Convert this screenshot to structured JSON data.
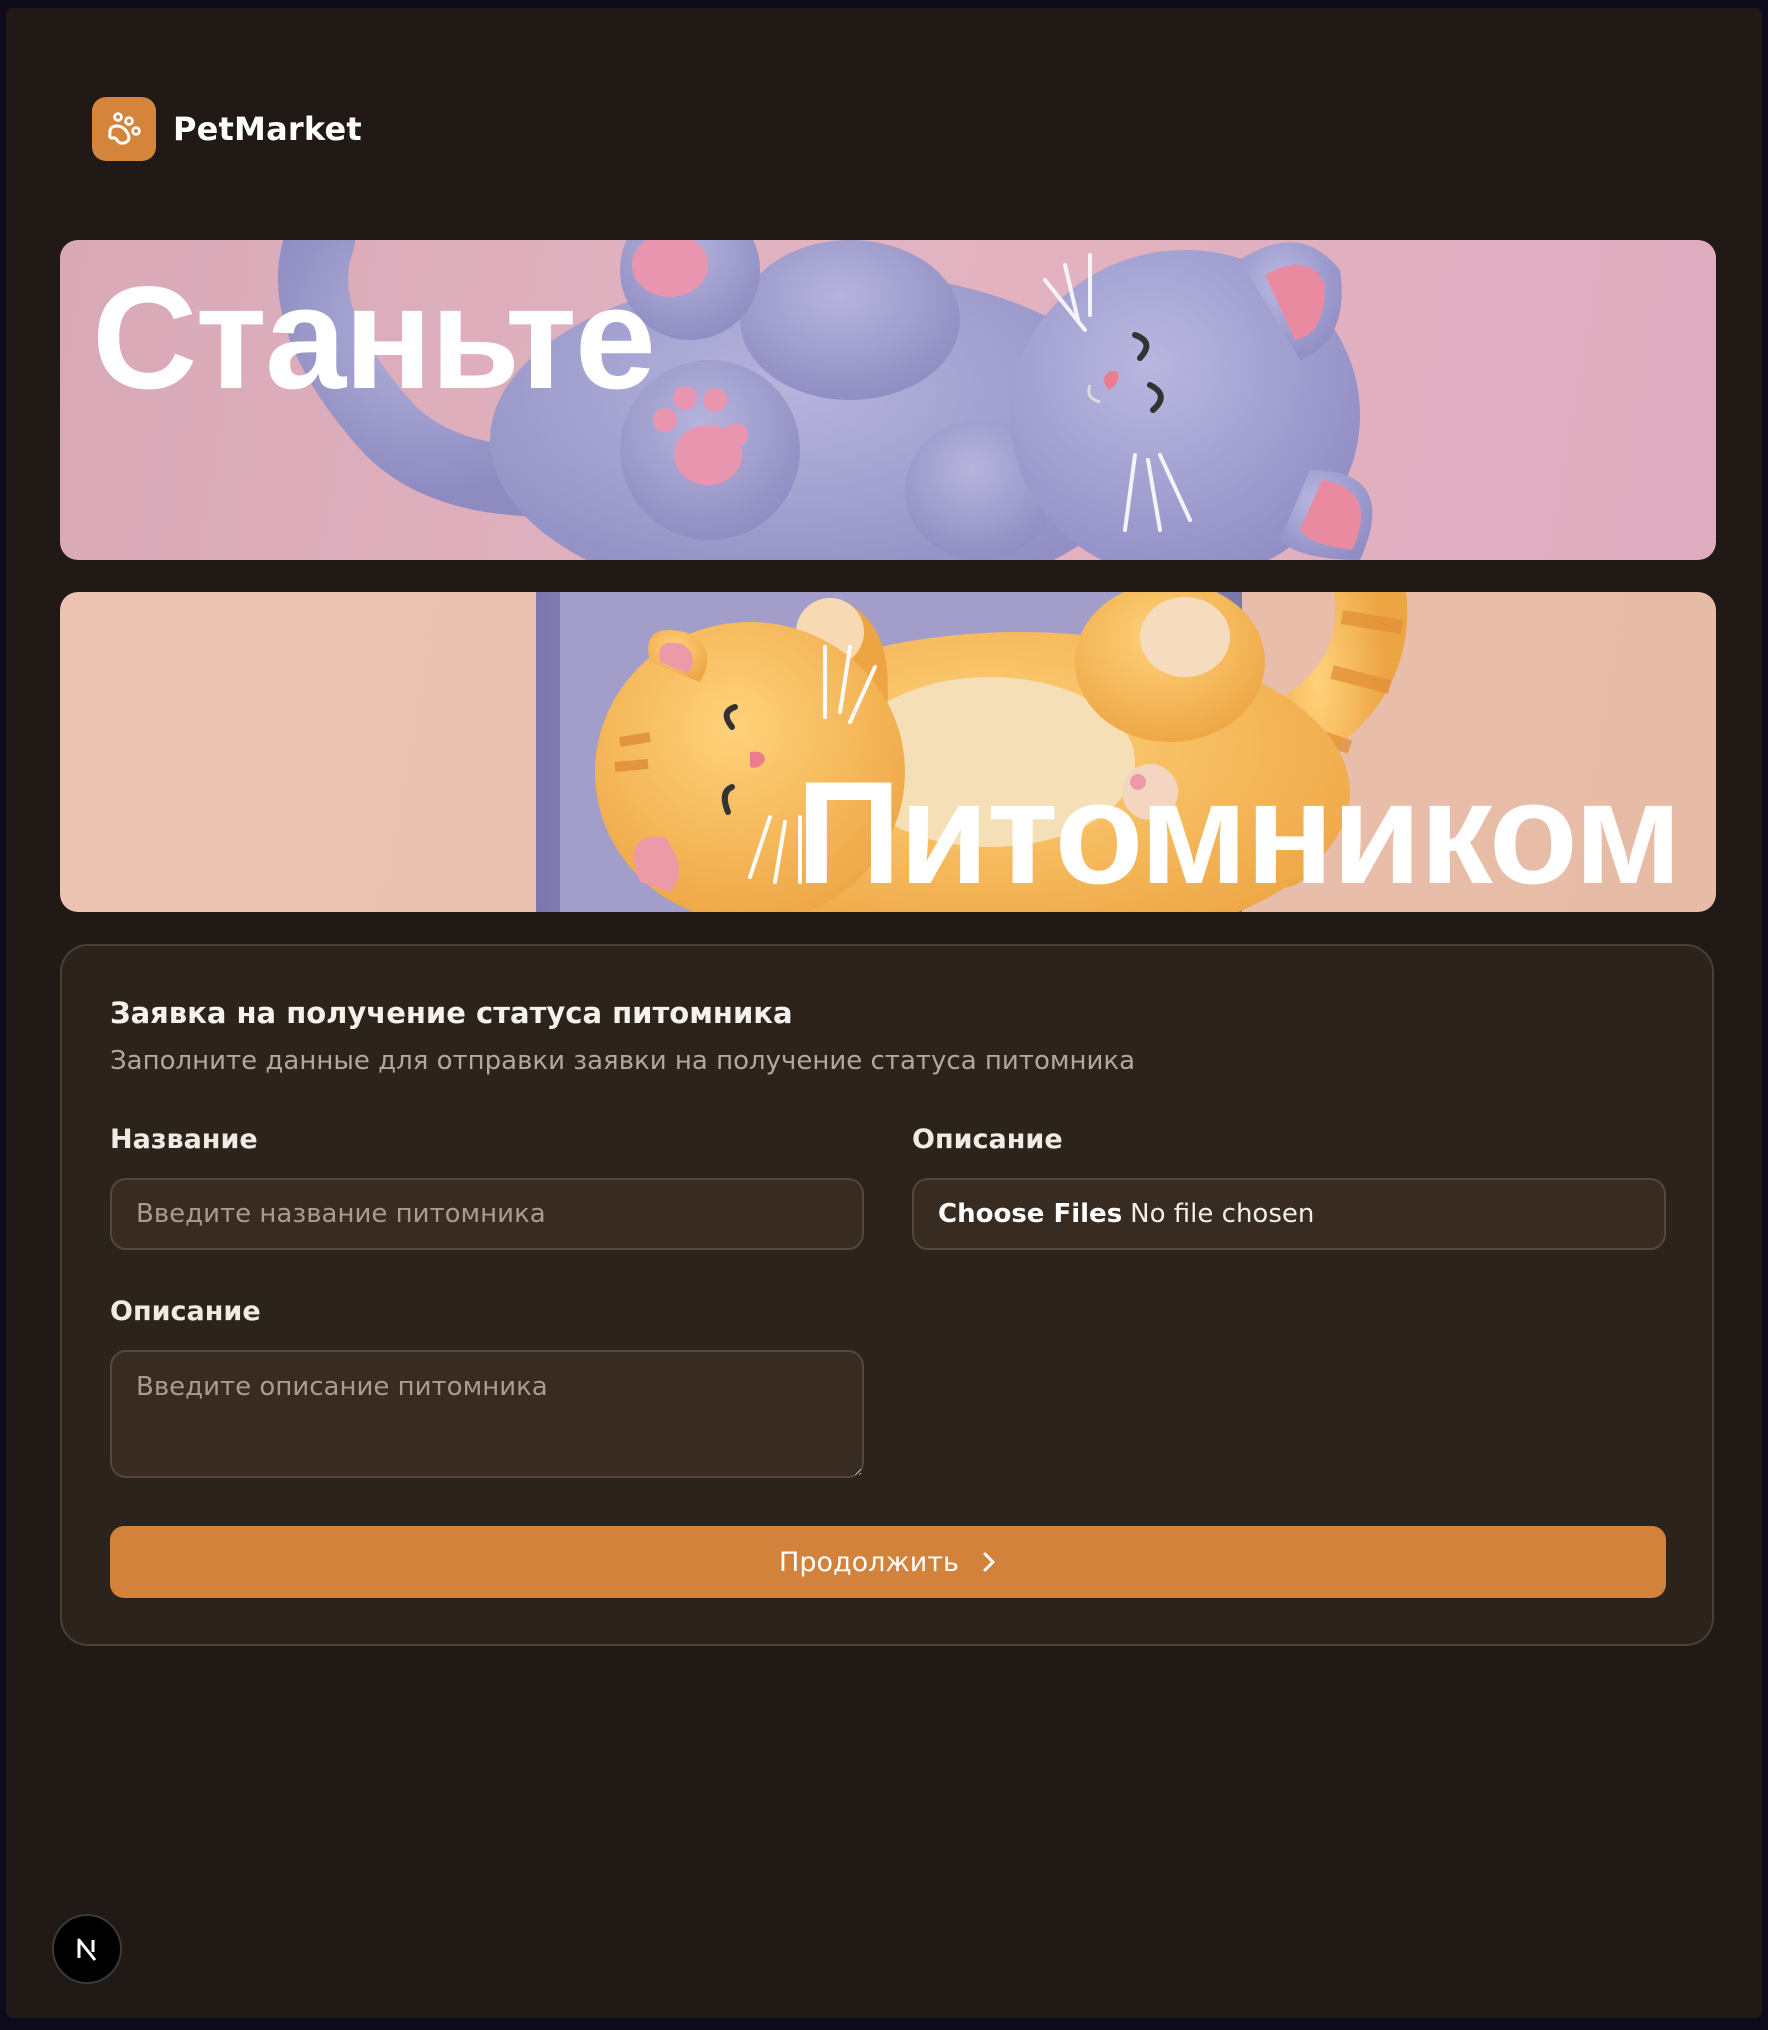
{
  "brand": {
    "name": "PetMarket",
    "icon": "paw-icon",
    "accent": "#d4843b"
  },
  "hero": {
    "line1": "Станьте",
    "line2": "Питомником"
  },
  "form": {
    "title": "Заявка на получение статуса питомника",
    "subtitle": "Заполните данные для отправки заявки на получение статуса питомника",
    "name_label": "Название",
    "name_placeholder": "Введите название питомника",
    "file_label": "Описание",
    "file_button": "Choose Files",
    "file_status": "No file chosen",
    "description_label": "Описание",
    "description_placeholder": "Введите описание питомника",
    "submit_label": "Продолжить",
    "submit_icon": "chevron-right-icon",
    "button_color": "#d2823b"
  },
  "dev_badge": {
    "letter": "N",
    "icon": "nextjs-logo-icon"
  }
}
